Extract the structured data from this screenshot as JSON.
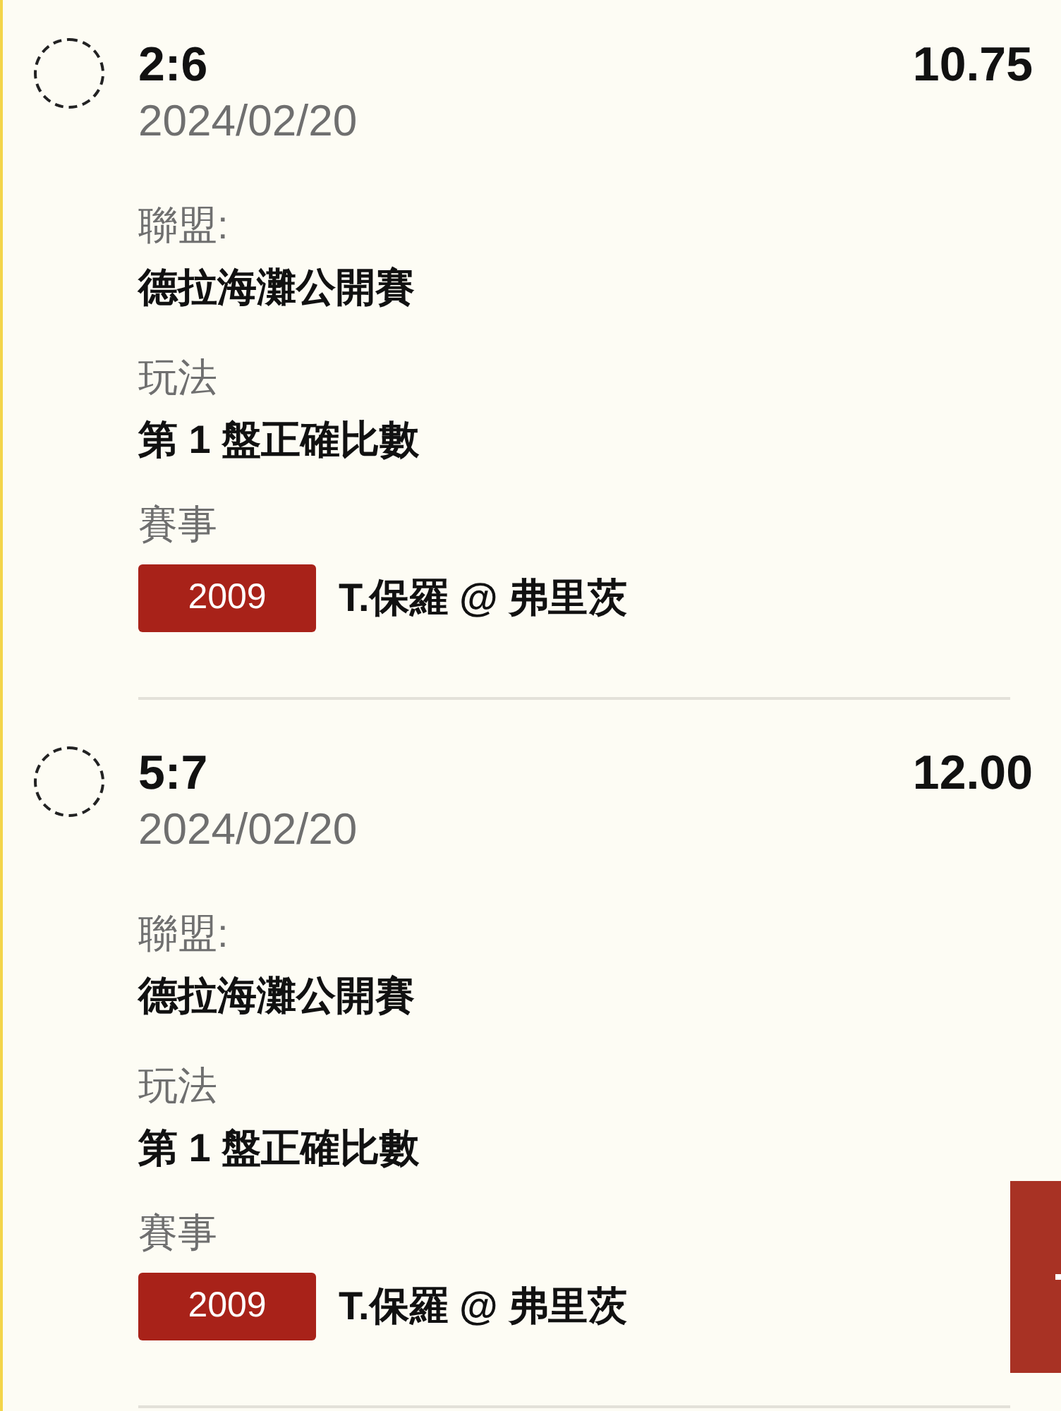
{
  "bets": [
    {
      "selected": false,
      "score": "2:6",
      "date": "2024/02/20",
      "odds": "10.75",
      "league_label": "聯盟:",
      "league": "德拉海灘公開賽",
      "market_label": "玩法",
      "market": "第 1 盤正確比數",
      "event_label": "賽事",
      "event_code": "2009",
      "event": "T.保羅 @ 弗里茨"
    },
    {
      "selected": false,
      "score": "5:7",
      "date": "2024/02/20",
      "odds": "12.00",
      "league_label": "聯盟:",
      "league": "德拉海灘公開賽",
      "market_label": "玩法",
      "market": "第 1 盤正確比數",
      "event_label": "賽事",
      "event_code": "2009",
      "event": "T.保羅 @ 弗里茨"
    }
  ]
}
